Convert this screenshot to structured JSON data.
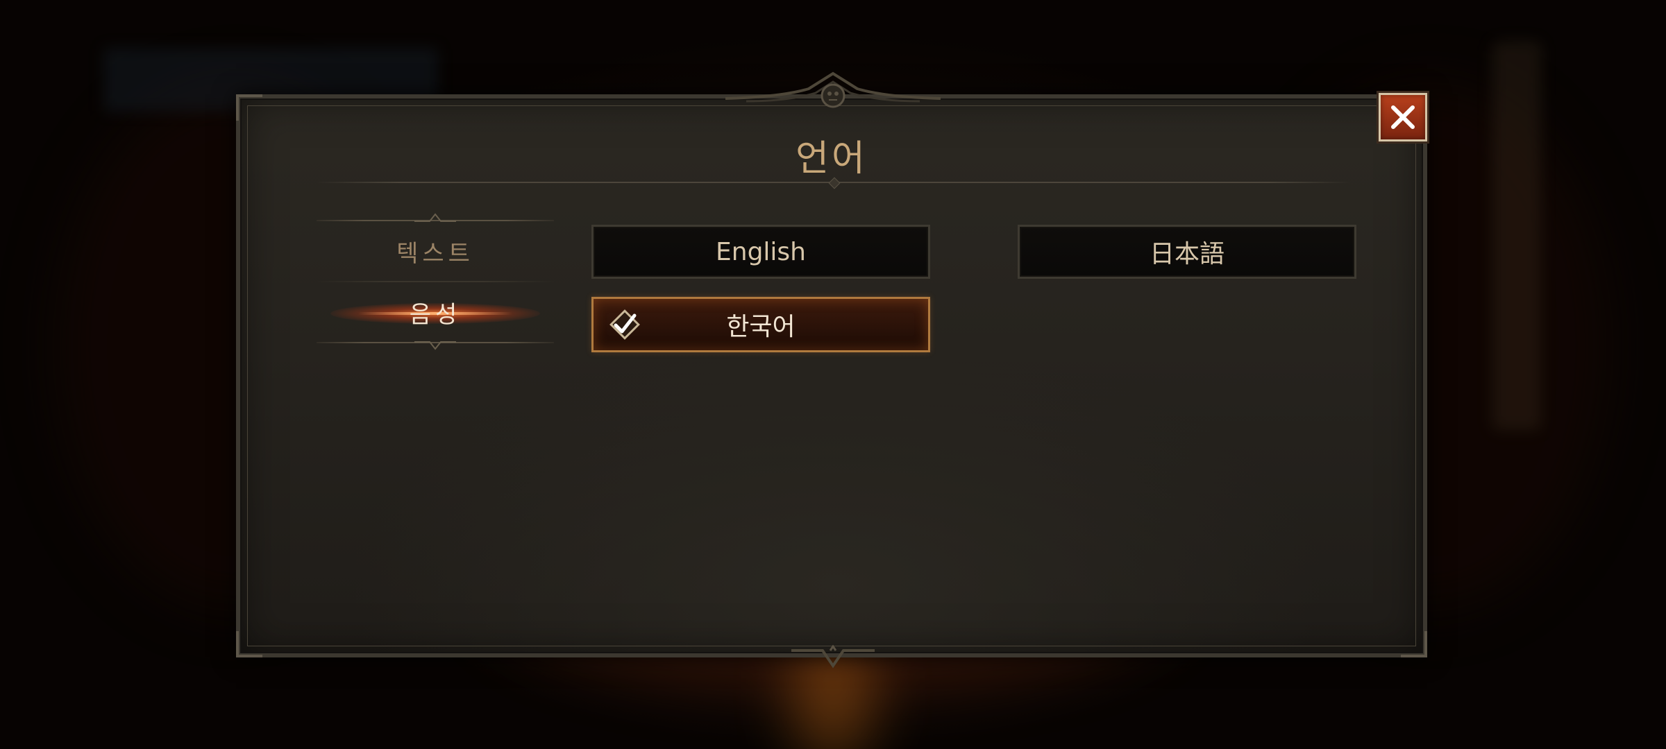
{
  "dialog": {
    "title": "언어",
    "tabs": [
      {
        "label": "텍스트",
        "selected": false
      },
      {
        "label": "음성",
        "selected": true
      }
    ],
    "languages": [
      {
        "label": "English",
        "selected": false
      },
      {
        "label": "日本語",
        "selected": false
      },
      {
        "label": "한국어",
        "selected": true
      }
    ]
  },
  "icons": {
    "close": "close-icon",
    "check": "checkmark-icon"
  },
  "colors": {
    "title": "#c9a87a",
    "selected_border": "#b07a3e",
    "close_button": "#b8401c"
  }
}
